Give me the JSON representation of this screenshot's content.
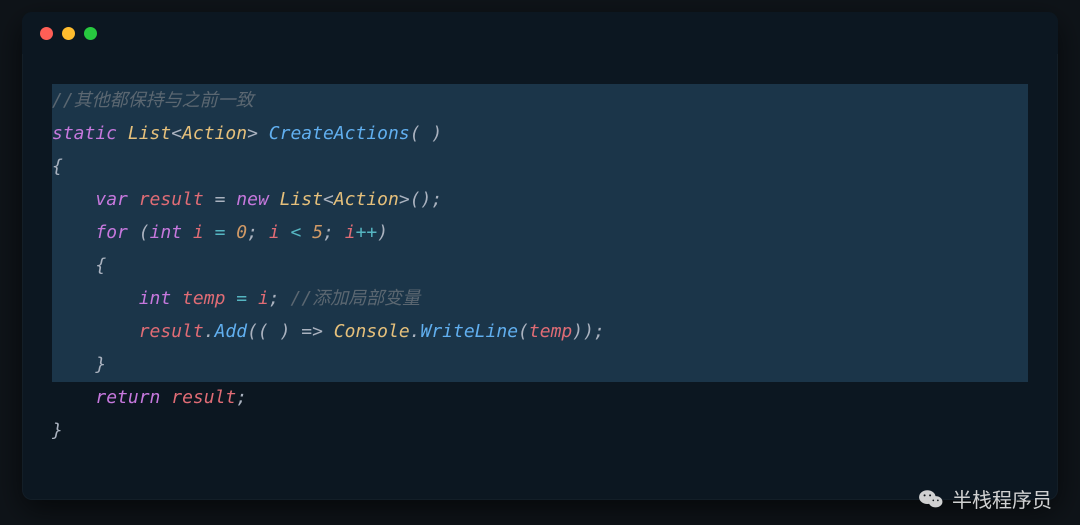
{
  "window": {
    "controls": [
      "close",
      "minimize",
      "zoom"
    ]
  },
  "code": {
    "line1_comment": "//其他都保持与之前一致",
    "kw_static": "static",
    "type_list": "List",
    "type_action": "Action",
    "method_name": "CreateActions",
    "brace_open": "{",
    "brace_close": "}",
    "kw_var": "var",
    "ident_result": "result",
    "op_assign": " = ",
    "kw_new": "new",
    "call_parens": "();",
    "kw_for": "for",
    "kw_int": "int",
    "ident_i": "i",
    "num_zero": "0",
    "num_five": "5",
    "op_lt": "<",
    "op_inc": "++",
    "kw_int2": "int",
    "ident_temp": "temp",
    "line7_comment": "//添加局部变量",
    "method_add": "Add",
    "lambda": "(( ) => ",
    "type_console": "Console",
    "method_writeline": "WriteLine",
    "ident_temp2": "temp",
    "kw_return": "return",
    "ident_result2": "result",
    "semicolon": ";",
    "paren_open": "(",
    "paren_close": ")",
    "angle_open": "<",
    "angle_close": ">",
    "comma": ", ",
    "dot": "."
  },
  "watermark": {
    "text": "半栈程序员"
  }
}
